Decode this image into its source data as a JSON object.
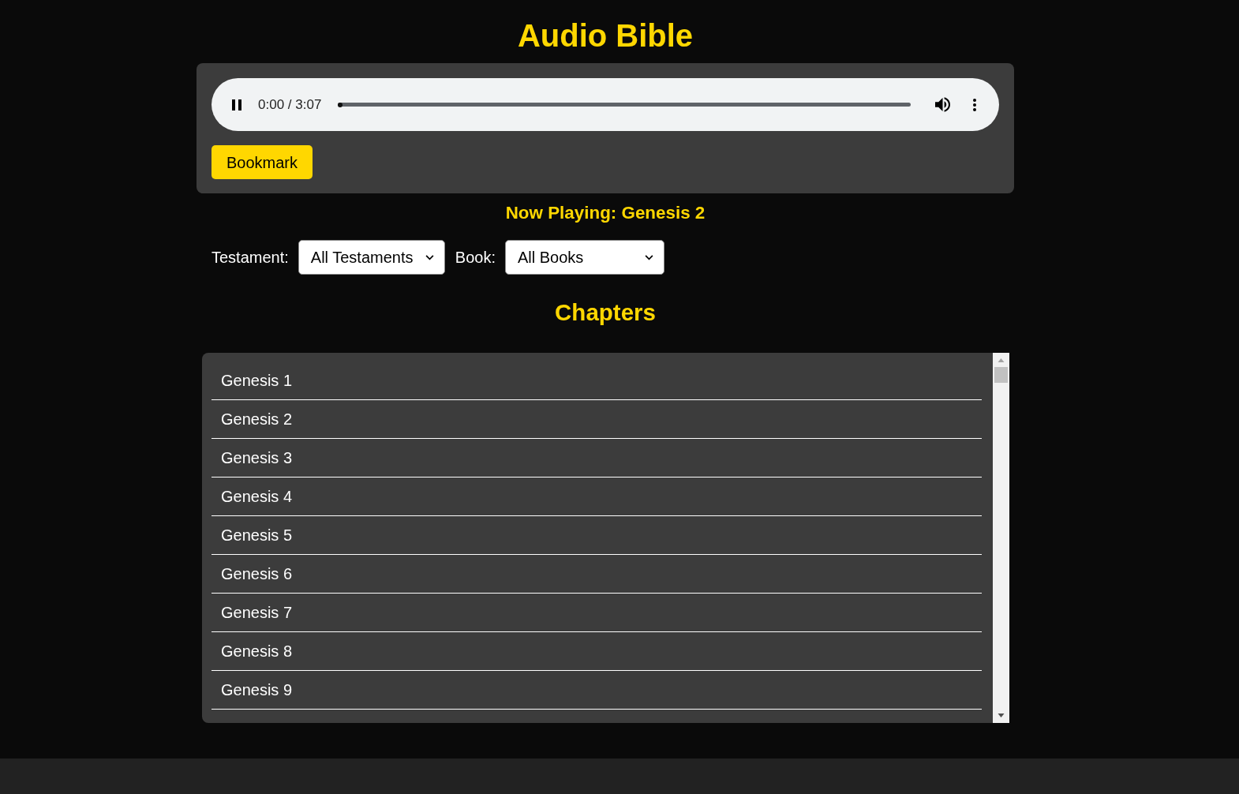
{
  "title": "Audio Bible",
  "player": {
    "playing": true,
    "time": "0:00 / 3:07",
    "level": 0
  },
  "bookmark_button": "Bookmark",
  "now_playing": "Now Playing: Genesis 2",
  "filters": [
    {
      "label": "Testament:",
      "value": "All Testaments"
    },
    {
      "label": "Book:",
      "value": "All Books"
    }
  ],
  "chapters_heading": "Chapters",
  "chapters": [
    "Genesis 1",
    "Genesis 2",
    "Genesis 3",
    "Genesis 4",
    "Genesis 5",
    "Genesis 6",
    "Genesis 7",
    "Genesis 8",
    "Genesis 9"
  ]
}
